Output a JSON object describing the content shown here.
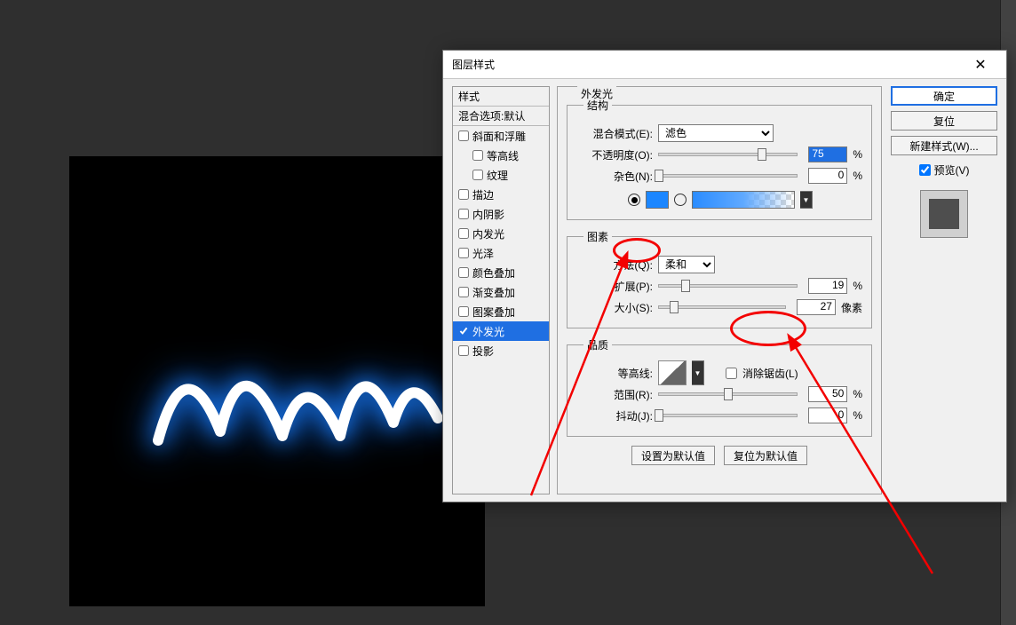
{
  "dialog": {
    "title": "图层样式",
    "close_label": "✕",
    "styles_header": "样式",
    "blend_options_header": "混合选项:默认",
    "effects": [
      {
        "label": "斜面和浮雕",
        "checked": false
      },
      {
        "label": "等高线",
        "checked": false,
        "sub": true
      },
      {
        "label": "纹理",
        "checked": false,
        "sub": true
      },
      {
        "label": "描边",
        "checked": false
      },
      {
        "label": "内阴影",
        "checked": false
      },
      {
        "label": "内发光",
        "checked": false
      },
      {
        "label": "光泽",
        "checked": false
      },
      {
        "label": "颜色叠加",
        "checked": false
      },
      {
        "label": "渐变叠加",
        "checked": false
      },
      {
        "label": "图案叠加",
        "checked": false
      },
      {
        "label": "外发光",
        "checked": true,
        "selected": true
      },
      {
        "label": "投影",
        "checked": false
      }
    ],
    "panel_title": "外发光",
    "structure": {
      "legend": "结构",
      "blend_mode_label": "混合模式(E):",
      "blend_mode_value": "滤色",
      "opacity_label": "不透明度(O):",
      "opacity_value": "75",
      "opacity_unit": "%",
      "noise_label": "杂色(N):",
      "noise_value": "0",
      "noise_unit": "%"
    },
    "elements": {
      "legend": "图素",
      "technique_label": "方法(Q):",
      "technique_value": "柔和",
      "spread_label": "扩展(P):",
      "spread_value": "19",
      "spread_unit": "%",
      "size_label": "大小(S):",
      "size_value": "27",
      "size_unit": "像素"
    },
    "quality": {
      "legend": "品质",
      "contour_label": "等高线:",
      "anti_alias_label": "消除锯齿(L)",
      "range_label": "范围(R):",
      "range_value": "50",
      "range_unit": "%",
      "jitter_label": "抖动(J):",
      "jitter_value": "0",
      "jitter_unit": "%"
    },
    "defaults": {
      "make_default": "设置为默认值",
      "reset_default": "复位为默认值"
    },
    "buttons": {
      "ok": "确定",
      "cancel": "复位",
      "new_style": "新建样式(W)...",
      "preview": "预览(V)"
    }
  }
}
